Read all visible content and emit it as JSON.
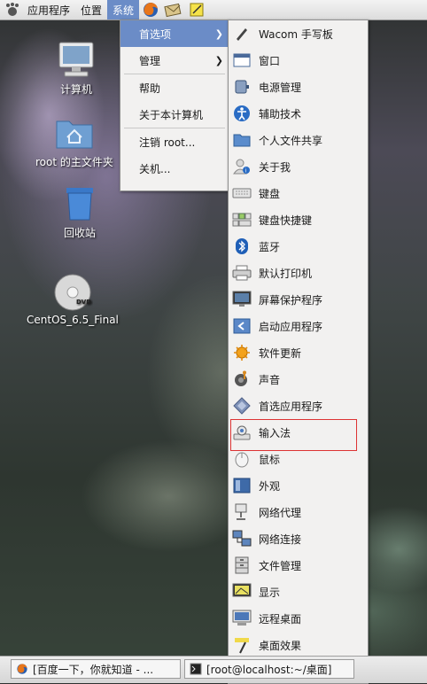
{
  "top_panel": {
    "applications": "应用程序",
    "places": "位置",
    "system": "系统"
  },
  "desktop": {
    "computer": "计算机",
    "home": "root 的主文件夹",
    "trash": "回收站",
    "dvd": "CentOS_6.5_Final",
    "dvd_badge": "DVD"
  },
  "system_menu": {
    "items": [
      {
        "label": "首选项",
        "has_submenu": true,
        "selected": true
      },
      {
        "label": "管理",
        "has_submenu": true
      },
      {
        "label": "帮助"
      },
      {
        "label": "关于本计算机"
      },
      {
        "label": "注销 root..."
      },
      {
        "label": "关机..."
      }
    ],
    "arrow": "❯"
  },
  "preferences_menu": {
    "items": [
      {
        "label": "Wacom 手写板",
        "icon": "pen-icon"
      },
      {
        "label": "窗口",
        "icon": "window-icon"
      },
      {
        "label": "电源管理",
        "icon": "power-icon"
      },
      {
        "label": "辅助技术",
        "icon": "accessibility-icon"
      },
      {
        "label": "个人文件共享",
        "icon": "folder-share-icon"
      },
      {
        "label": "关于我",
        "icon": "about-me-icon"
      },
      {
        "label": "键盘",
        "icon": "keyboard-icon"
      },
      {
        "label": "键盘快捷键",
        "icon": "shortcuts-icon"
      },
      {
        "label": "蓝牙",
        "icon": "bluetooth-icon"
      },
      {
        "label": "默认打印机",
        "icon": "printer-icon"
      },
      {
        "label": "屏幕保护程序",
        "icon": "screensaver-icon"
      },
      {
        "label": "启动应用程序",
        "icon": "startup-icon"
      },
      {
        "label": "软件更新",
        "icon": "update-icon"
      },
      {
        "label": "声音",
        "icon": "sound-icon"
      },
      {
        "label": "首选应用程序",
        "icon": "preferred-apps-icon"
      },
      {
        "label": "输入法",
        "icon": "input-method-icon",
        "highlighted": true
      },
      {
        "label": "鼠标",
        "icon": "mouse-icon"
      },
      {
        "label": "外观",
        "icon": "appearance-icon"
      },
      {
        "label": "网络代理",
        "icon": "proxy-icon"
      },
      {
        "label": "网络连接",
        "icon": "network-icon"
      },
      {
        "label": "文件管理",
        "icon": "file-manager-icon"
      },
      {
        "label": "显示",
        "icon": "display-icon"
      },
      {
        "label": "远程桌面",
        "icon": "remote-desktop-icon"
      },
      {
        "label": "桌面效果",
        "icon": "desktop-effects-icon"
      }
    ]
  },
  "taskbar": {
    "tasks": [
      {
        "label": "[百度一下，你就知道 - ..."
      },
      {
        "label": "[root@localhost:~/桌面]"
      }
    ]
  },
  "colors": {
    "menu_selected": "#6b8cc7",
    "highlight_border": "#dd3333"
  }
}
